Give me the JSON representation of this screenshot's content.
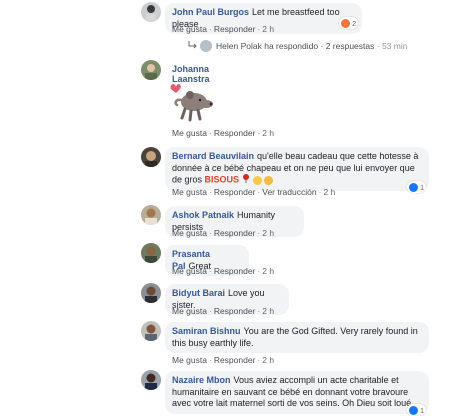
{
  "common": {
    "like": "Me gusta",
    "reply": "Responder",
    "dot": "·"
  },
  "comments": [
    {
      "name": "John Paul Burgos",
      "text": "Let me breastfeed too please",
      "time": "2 h",
      "reactions": "2"
    },
    {
      "name": "Johanna Laanstra",
      "text": "",
      "time": "2 h"
    },
    {
      "name": "Bernard Beauvilain",
      "text": "qu'elle beau cadeau que cette hotesse à donnée à ce bébé chapeau et on ne peu que lui envoyer que de gros",
      "bisous": "BISOUS",
      "time": "2 h",
      "translate": "Ver traducción",
      "reactions": "1"
    },
    {
      "name": "Ashok Patnaik",
      "text": "Humanity persists",
      "time": "2 h"
    },
    {
      "name": "Prasanta Pal",
      "text": "Great",
      "time": "2 h"
    },
    {
      "name": "Bidyut Barai",
      "text": "Love you sister.",
      "time": "2 h"
    },
    {
      "name": "Samiran Bishnu",
      "text": "You are the God Gifted. Very rarely found in this busy earthly life.",
      "time": "2 h"
    },
    {
      "name": "Nazaire Mbon",
      "text": "Vous aviez accompli un acte charitable et humanitaire en sauvant ce bébé en donnant votre bravoure avec votre lait maternel sorti de vos seins. Oh Dieu soit loué",
      "reactions": "1"
    }
  ],
  "replies_summary": {
    "name": "Helen Polak",
    "action": "ha respondido",
    "count": "2 respuestas",
    "time": "53 min"
  },
  "colors": {
    "name_blue": "#385898",
    "bubble": "#f2f3f5",
    "like_blue": "#1877f2",
    "haha_yellow": "#f7c948",
    "bisous_red": "#e4422c"
  }
}
